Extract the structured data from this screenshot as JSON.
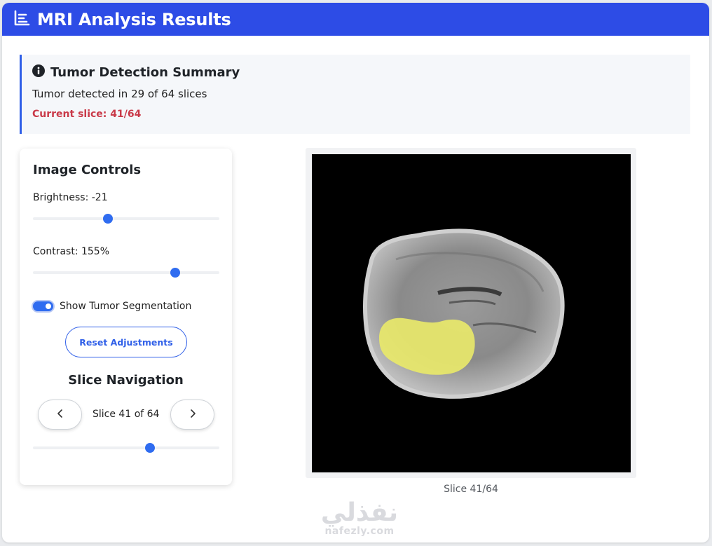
{
  "header": {
    "title": "MRI Analysis Results",
    "icon": "chart-list-icon",
    "color": "#2d4ce6"
  },
  "summary": {
    "icon": "info-circle-icon",
    "title": "Tumor Detection Summary",
    "detected_text": "Tumor detected in 29 of 64 slices",
    "current_slice_text": "Current slice: 41/64",
    "accent_color": "#c93a49"
  },
  "controls": {
    "heading": "Image Controls",
    "brightness_label": "Brightness: -21",
    "brightness_value": -21,
    "contrast_label": "Contrast: 155%",
    "contrast_value": 155,
    "toggle_label": "Show Tumor Segmentation",
    "toggle_on": true,
    "reset_label": "Reset Adjustments"
  },
  "navigation": {
    "heading": "Slice Navigation",
    "prev_icon": "chevron-left-icon",
    "next_icon": "chevron-right-icon",
    "slice_text": "Slice 41 of 64",
    "current_slice": 41,
    "total_slices": 64
  },
  "viewer": {
    "caption": "Slice 41/64",
    "segmentation_color": "#e8e86a"
  },
  "watermark": {
    "arabic": "نفذلي",
    "latin": "nafezly.com"
  }
}
